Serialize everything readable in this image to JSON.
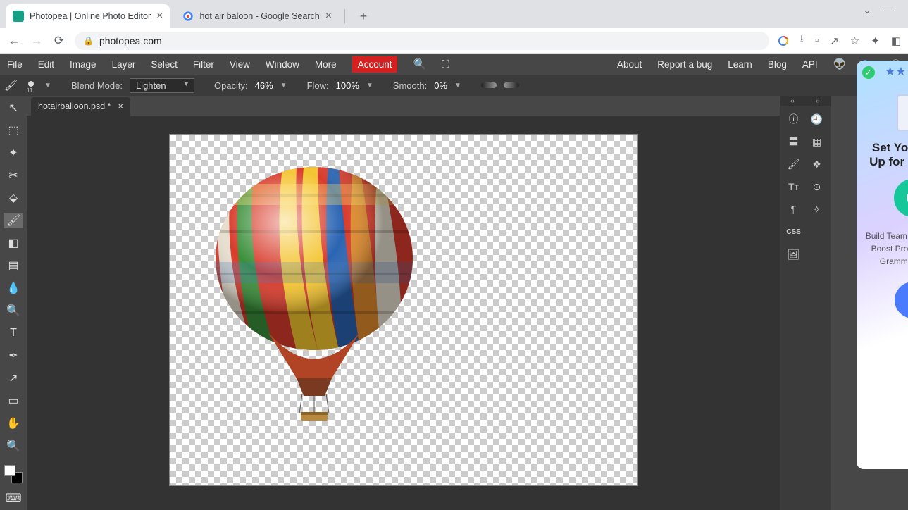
{
  "browser": {
    "tabs": [
      {
        "title": "Photopea | Online Photo Editor",
        "favicon": "photopea"
      },
      {
        "title": "hot air baloon - Google Search",
        "favicon": "google"
      }
    ],
    "url": "photopea.com",
    "win": {
      "min": "⌄",
      "rest": "—"
    },
    "actions": {
      "star": "☆"
    }
  },
  "menubar": [
    "File",
    "Edit",
    "Image",
    "Layer",
    "Select",
    "Filter",
    "View",
    "Window",
    "More"
  ],
  "account": "Account",
  "menuright": [
    "About",
    "Report a bug",
    "Learn",
    "Blog",
    "API"
  ],
  "opts": {
    "brush_size": "11",
    "blend_label": "Blend Mode:",
    "blend_value": "Lighten",
    "opacity_label": "Opacity:",
    "opacity_value": "46%",
    "flow_label": "Flow:",
    "flow_value": "100%",
    "smooth_label": "Smooth:",
    "smooth_value": "0%"
  },
  "doc_tab": "hotairballoon.psd *",
  "right_panel": {
    "css": "CSS"
  },
  "ad": {
    "stars": "★★★",
    "title": "Set Your Team Up for Success",
    "body": "Build Team Confidence & Boost Production With Grammarly Today",
    "btn": "›"
  },
  "tools": [
    {
      "n": "move-tool",
      "g": "↖"
    },
    {
      "n": "marquee-tool",
      "g": "⬚"
    },
    {
      "n": "wand-tool",
      "g": "✦"
    },
    {
      "n": "crop-tool",
      "g": "✂"
    },
    {
      "n": "eyedropper-tool",
      "g": "⬙"
    },
    {
      "n": "brush-tool",
      "g": "🖌",
      "sel": true
    },
    {
      "n": "eraser-tool",
      "g": "◧"
    },
    {
      "n": "gradient-tool",
      "g": "▤"
    },
    {
      "n": "blur-tool",
      "g": "💧"
    },
    {
      "n": "dodge-tool",
      "g": "🔍"
    },
    {
      "n": "type-tool",
      "g": "T"
    },
    {
      "n": "pen-tool",
      "g": "✒"
    },
    {
      "n": "path-tool",
      "g": "↗"
    },
    {
      "n": "shape-tool",
      "g": "▭"
    },
    {
      "n": "hand-tool",
      "g": "✋"
    },
    {
      "n": "zoom-tool",
      "g": "🔍"
    }
  ],
  "rp_icons": [
    {
      "n": "info-icon",
      "g": "ⓘ"
    },
    {
      "n": "history-icon",
      "g": "🕘"
    },
    {
      "n": "adjust-icon",
      "g": "〓"
    },
    {
      "n": "swatches-icon",
      "g": "▦"
    },
    {
      "n": "brushprops-icon",
      "g": "🖌"
    },
    {
      "n": "layers-icon",
      "g": "❖"
    },
    {
      "n": "char-icon",
      "g": "Tᴛ"
    },
    {
      "n": "channels-icon",
      "g": "⊙"
    },
    {
      "n": "para-icon",
      "g": "¶"
    },
    {
      "n": "paths-icon",
      "g": "✧"
    }
  ],
  "canvas_image": "hot air balloon with multicolored panels on transparent background"
}
